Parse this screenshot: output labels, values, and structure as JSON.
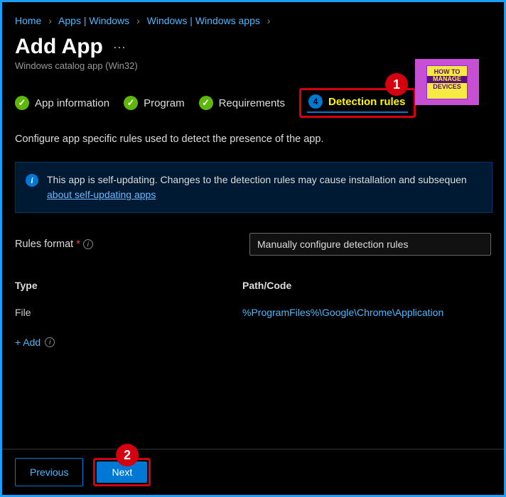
{
  "breadcrumb": {
    "items": [
      "Home",
      "Apps | Windows",
      "Windows | Windows apps"
    ]
  },
  "title": "Add App",
  "subtitle": "Windows catalog app (Win32)",
  "logo": {
    "line1": "HOW TO",
    "line2": "MANAGE",
    "line3": "DEVICES"
  },
  "markers": {
    "one": "1",
    "two": "2"
  },
  "steps": [
    {
      "label": "App information",
      "done": true
    },
    {
      "label": "Program",
      "done": true
    },
    {
      "label": "Requirements",
      "done": true
    },
    {
      "label": "Detection rules",
      "num": "4",
      "active": true
    }
  ],
  "description": "Configure app specific rules used to detect the presence of the app.",
  "info": {
    "text": "This app is self-updating. Changes to the detection rules may cause installation and subsequen",
    "link": "about self-updating apps"
  },
  "form": {
    "rules_format_label": "Rules format",
    "rules_format_value": "Manually configure detection rules"
  },
  "table": {
    "headers": {
      "type": "Type",
      "path": "Path/Code"
    },
    "rows": [
      {
        "type": "File",
        "path": "%ProgramFiles%\\Google\\Chrome\\Application"
      }
    ]
  },
  "add_label": "+ Add",
  "buttons": {
    "previous": "Previous",
    "next": "Next"
  }
}
